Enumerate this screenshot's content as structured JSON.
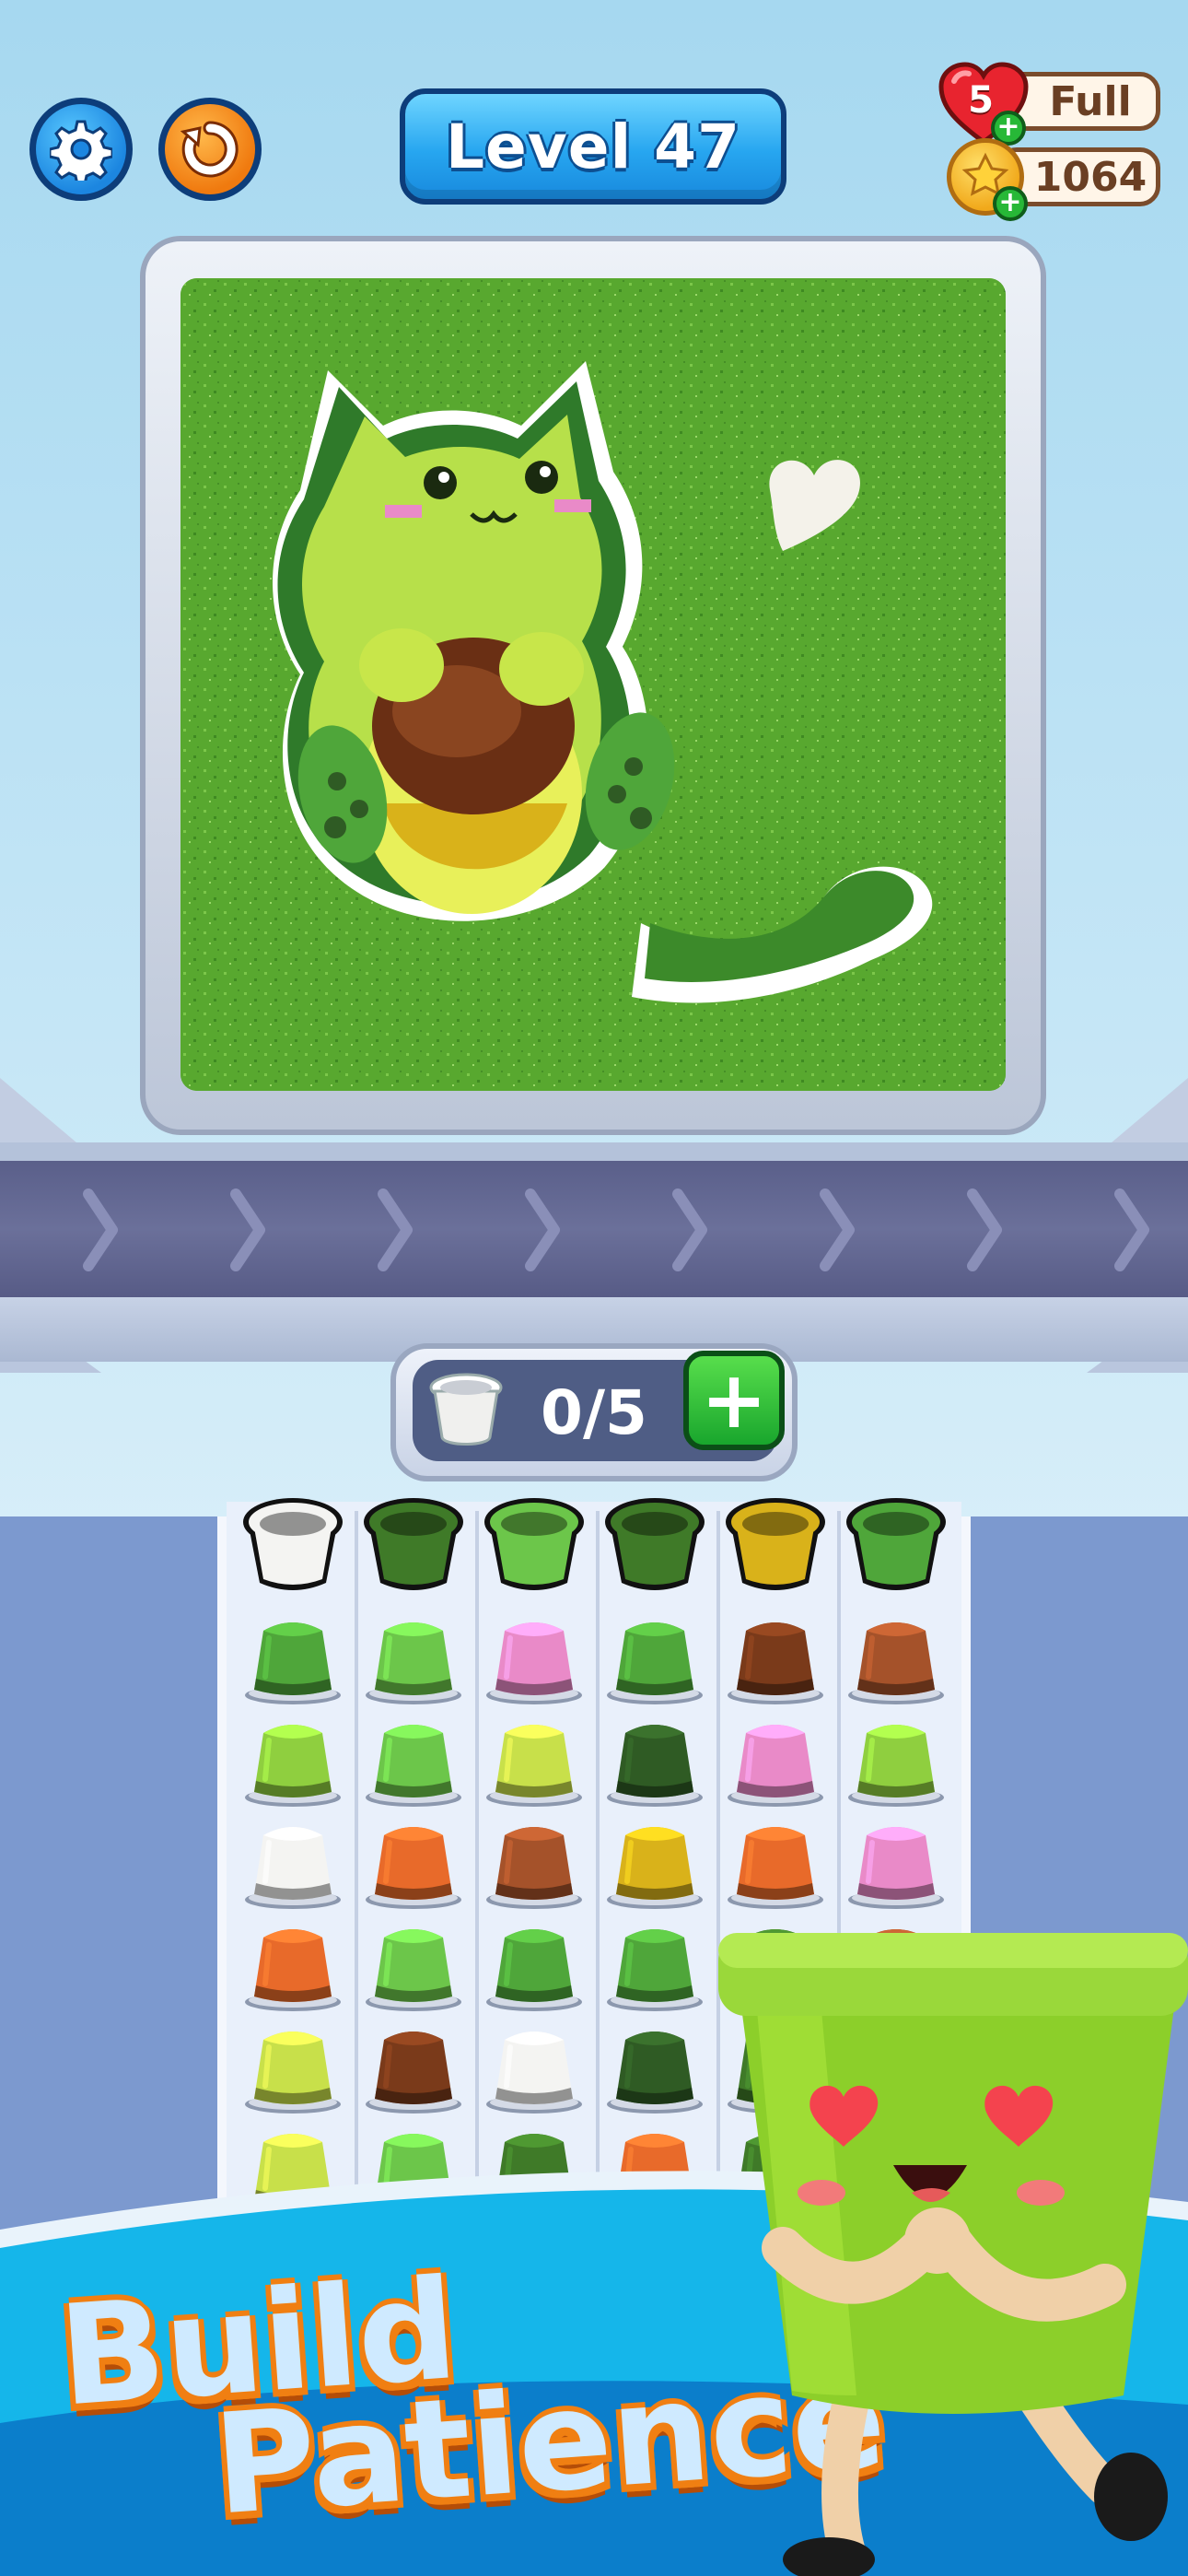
{
  "header": {
    "level_label": "Level 47",
    "lives_count": "5",
    "lives_status": "Full",
    "coins": "1064"
  },
  "counter": {
    "text": "0/5",
    "add_label": "+"
  },
  "banner": {
    "line1": "Build",
    "line2": "Patience"
  },
  "pot_colors": {
    "white": "#f4f4f2",
    "dark_green": "#3f7a28",
    "green": "#4fa63a",
    "light_green": "#6cc64a",
    "lime": "#c8e04a",
    "pink": "#e98ac8",
    "brown": "#7a3a1a",
    "rust": "#a5522a",
    "orange": "#e86a2a",
    "olive": "#2f5b24",
    "gold": "#d9b21a",
    "yellow_green": "#8fcf3f"
  },
  "slot_row": [
    "white",
    "dark_green",
    "light_green",
    "dark_green",
    "gold",
    "green"
  ],
  "grid_rows": [
    [
      "green",
      "light_green",
      "pink",
      "green",
      "brown",
      "rust"
    ],
    [
      "yellow_green",
      "light_green",
      "lime",
      "olive",
      "pink",
      "yellow_green"
    ],
    [
      "white",
      "orange",
      "rust",
      "gold",
      "orange",
      "pink"
    ],
    [
      "orange",
      "light_green",
      "green",
      "green",
      "dark_green",
      "rust"
    ],
    [
      "lime",
      "brown",
      "white",
      "olive",
      "dark_green",
      "pink"
    ],
    [
      "lime",
      "light_green",
      "dark_green",
      "orange",
      "dark_green",
      "green"
    ]
  ]
}
